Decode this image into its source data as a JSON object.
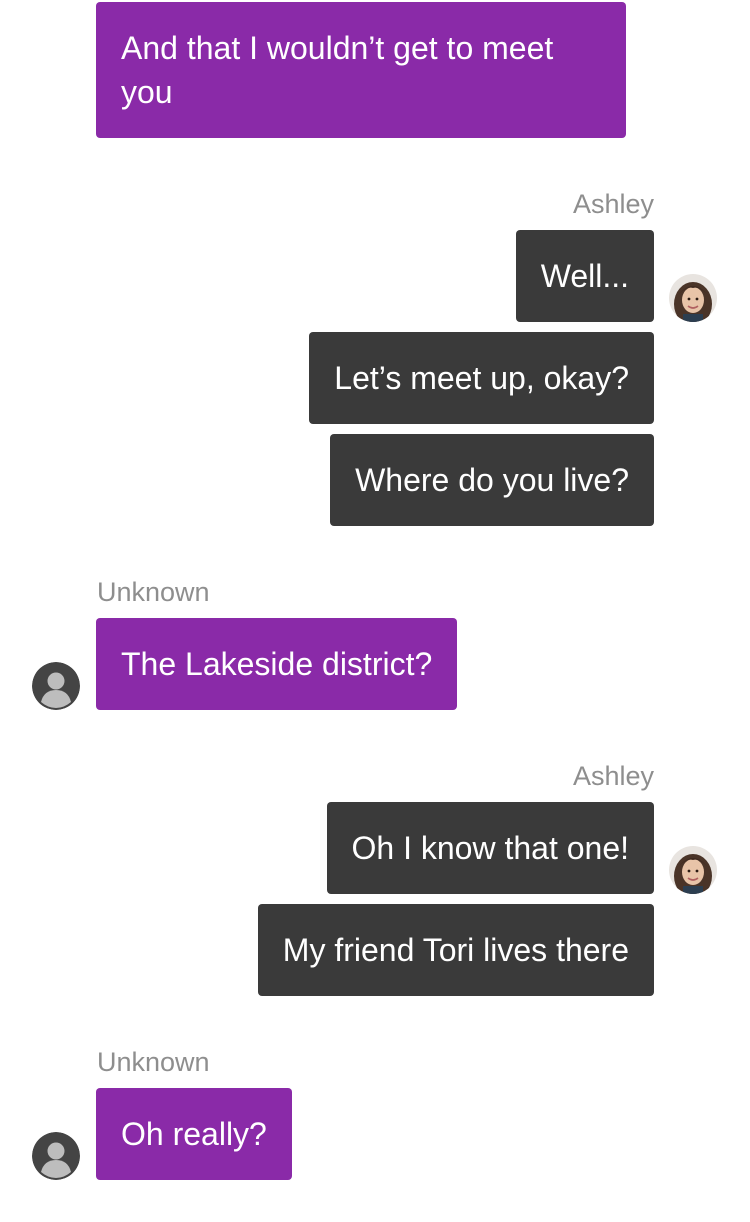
{
  "messages": [
    {
      "sender": "Unknown",
      "text": "And that I wouldn’t get to meet you"
    },
    {
      "sender": "Ashley",
      "text": "Well..."
    },
    {
      "sender": "Ashley",
      "text": "Let’s meet up, okay?"
    },
    {
      "sender": "Ashley",
      "text": "Where do you live?"
    },
    {
      "sender": "Unknown",
      "text": "The Lakeside district?"
    },
    {
      "sender": "Ashley",
      "text": "Oh I know that one!"
    },
    {
      "sender": "Ashley",
      "text": "My friend Tori lives there"
    },
    {
      "sender": "Unknown",
      "text": "Oh really?"
    }
  ],
  "senders": {
    "ashley_label_1": "Ashley",
    "unknown_label_1": "Unknown",
    "ashley_label_2": "Ashley",
    "unknown_label_2": "Unknown"
  },
  "colors": {
    "incoming_bubble": "#8a2aa8",
    "outgoing_bubble": "#3a3a3a",
    "sender_label": "#8e8e8e",
    "background": "#ffffff"
  },
  "icons": {
    "ashley_avatar": "ashley-avatar-photo",
    "unknown_avatar": "default-user-icon"
  }
}
